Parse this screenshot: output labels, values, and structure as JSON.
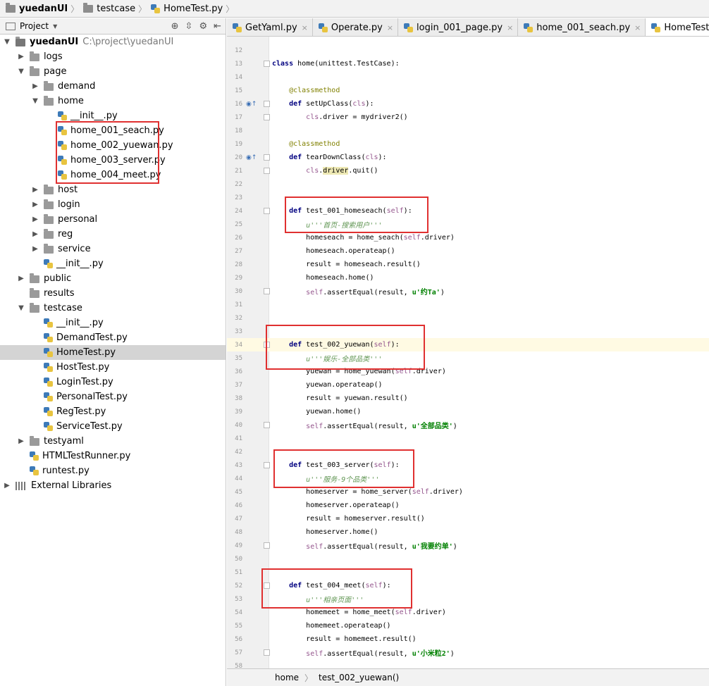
{
  "breadcrumb": [
    {
      "label": "yuedanUI",
      "icon": "folder-icon",
      "bold": true
    },
    {
      "label": "testcase",
      "icon": "folder-icon",
      "bold": false
    },
    {
      "label": "HomeTest.py",
      "icon": "python-file-icon",
      "bold": false
    }
  ],
  "project_panel": {
    "title": "Project",
    "tools": [
      "target-icon",
      "collapse-icon",
      "gear-icon",
      "hide-icon"
    ]
  },
  "tree": [
    {
      "depth": 0,
      "arrow": "open",
      "type": "root",
      "label": "yuedanUI",
      "path": "C:\\project\\yuedanUI"
    },
    {
      "depth": 1,
      "arrow": "closed",
      "type": "dir",
      "label": "logs"
    },
    {
      "depth": 1,
      "arrow": "open",
      "type": "dir",
      "label": "page"
    },
    {
      "depth": 2,
      "arrow": "closed",
      "type": "dir",
      "label": "demand"
    },
    {
      "depth": 2,
      "arrow": "open",
      "type": "dir",
      "label": "home"
    },
    {
      "depth": 3,
      "arrow": "none",
      "type": "file",
      "label": "__init__.py"
    },
    {
      "depth": 3,
      "arrow": "none",
      "type": "file",
      "label": "home_001_seach.py"
    },
    {
      "depth": 3,
      "arrow": "none",
      "type": "file",
      "label": "home_002_yuewan.py"
    },
    {
      "depth": 3,
      "arrow": "none",
      "type": "file",
      "label": "home_003_server.py"
    },
    {
      "depth": 3,
      "arrow": "none",
      "type": "file",
      "label": "home_004_meet.py"
    },
    {
      "depth": 2,
      "arrow": "closed",
      "type": "dir",
      "label": "host"
    },
    {
      "depth": 2,
      "arrow": "closed",
      "type": "dir",
      "label": "login"
    },
    {
      "depth": 2,
      "arrow": "closed",
      "type": "dir",
      "label": "personal"
    },
    {
      "depth": 2,
      "arrow": "closed",
      "type": "dir",
      "label": "reg"
    },
    {
      "depth": 2,
      "arrow": "closed",
      "type": "dir",
      "label": "service"
    },
    {
      "depth": 2,
      "arrow": "none",
      "type": "file",
      "label": "__init__.py"
    },
    {
      "depth": 1,
      "arrow": "closed",
      "type": "dir",
      "label": "public"
    },
    {
      "depth": 1,
      "arrow": "none",
      "type": "dir",
      "label": "results"
    },
    {
      "depth": 1,
      "arrow": "open",
      "type": "dir",
      "label": "testcase"
    },
    {
      "depth": 2,
      "arrow": "none",
      "type": "file",
      "label": "__init__.py"
    },
    {
      "depth": 2,
      "arrow": "none",
      "type": "file",
      "label": "DemandTest.py"
    },
    {
      "depth": 2,
      "arrow": "none",
      "type": "file",
      "label": "HomeTest.py",
      "selected": true
    },
    {
      "depth": 2,
      "arrow": "none",
      "type": "file",
      "label": "HostTest.py"
    },
    {
      "depth": 2,
      "arrow": "none",
      "type": "file",
      "label": "LoginTest.py"
    },
    {
      "depth": 2,
      "arrow": "none",
      "type": "file",
      "label": "PersonalTest.py"
    },
    {
      "depth": 2,
      "arrow": "none",
      "type": "file",
      "label": "RegTest.py"
    },
    {
      "depth": 2,
      "arrow": "none",
      "type": "file",
      "label": "ServiceTest.py"
    },
    {
      "depth": 1,
      "arrow": "closed",
      "type": "dir",
      "label": "testyaml"
    },
    {
      "depth": 1,
      "arrow": "none",
      "type": "file",
      "label": "HTMLTestRunner.py"
    },
    {
      "depth": 1,
      "arrow": "none",
      "type": "file",
      "label": "runtest.py"
    },
    {
      "depth": 0,
      "arrow": "closed",
      "type": "lib",
      "label": "External Libraries"
    }
  ],
  "tabs": [
    {
      "label": "GetYaml.py",
      "active": false
    },
    {
      "label": "Operate.py",
      "active": false
    },
    {
      "label": "login_001_page.py",
      "active": false
    },
    {
      "label": "home_001_seach.py",
      "active": false
    },
    {
      "label": "HomeTest.py",
      "active": true
    }
  ],
  "code_lines": [
    {
      "n": "12",
      "html": ""
    },
    {
      "n": "13",
      "html": "<span class='kw'>class</span> home(unittest.TestCase):",
      "fold": true
    },
    {
      "n": "14",
      "html": ""
    },
    {
      "n": "15",
      "html": "    <span class='deco'>@classmethod</span>"
    },
    {
      "n": "16",
      "html": "    <span class='kw'>def</span> setUpClass(<span class='selfc'>cls</span>):",
      "fold": true,
      "marker": true
    },
    {
      "n": "17",
      "html": "        <span class='selfc'>cls</span>.driver = mydriver2()",
      "fold": true
    },
    {
      "n": "18",
      "html": ""
    },
    {
      "n": "19",
      "html": "    <span class='deco'>@classmethod</span>"
    },
    {
      "n": "20",
      "html": "    <span class='kw'>def</span> tearDownClass(<span class='selfc'>cls</span>):",
      "fold": true,
      "marker": true
    },
    {
      "n": "21",
      "html": "        <span class='selfc'>cls</span>.<span class='hl'>driver</span>.quit()",
      "fold": true
    },
    {
      "n": "22",
      "html": ""
    },
    {
      "n": "23",
      "html": ""
    },
    {
      "n": "24",
      "html": "    <span class='kw'>def</span> test_001_homeseach(<span class='selfc'>self</span>):",
      "fold": true
    },
    {
      "n": "25",
      "html": "        <span class='doc'>u'''首页-搜索用户'''</span>"
    },
    {
      "n": "26",
      "html": "        homeseach = home_seach(<span class='selfc'>self</span>.driver)"
    },
    {
      "n": "27",
      "html": "        homeseach.operateap()"
    },
    {
      "n": "28",
      "html": "        result = homeseach.result()"
    },
    {
      "n": "29",
      "html": "        homeseach.home()"
    },
    {
      "n": "30",
      "html": "        <span class='selfc'>self</span>.assertEqual(result, <span class='str'>u'约Ta'</span>)",
      "fold": true
    },
    {
      "n": "31",
      "html": ""
    },
    {
      "n": "32",
      "html": ""
    },
    {
      "n": "33",
      "html": ""
    },
    {
      "n": "34",
      "html": "    <span class='kw'>def</span> test_002_yuewan(<span class='selfc'>self</span>):",
      "fold": true,
      "current": true
    },
    {
      "n": "35",
      "html": "        <span class='doc'>u'''娱乐-全部品类'''</span>"
    },
    {
      "n": "36",
      "html": "        yuewan = home_yuewan(<span class='selfc'>self</span>.driver)"
    },
    {
      "n": "37",
      "html": "        yuewan.operateap()"
    },
    {
      "n": "38",
      "html": "        result = yuewan.result()"
    },
    {
      "n": "39",
      "html": "        yuewan.home()"
    },
    {
      "n": "40",
      "html": "        <span class='selfc'>self</span>.assertEqual(result, <span class='str'>u'全部品类'</span>)",
      "fold": true
    },
    {
      "n": "41",
      "html": ""
    },
    {
      "n": "42",
      "html": ""
    },
    {
      "n": "43",
      "html": "    <span class='kw'>def</span> test_003_server(<span class='selfc'>self</span>):",
      "fold": true
    },
    {
      "n": "44",
      "html": "        <span class='doc'>u'''服务-9个品类'''</span>"
    },
    {
      "n": "45",
      "html": "        homeserver = home_server(<span class='selfc'>self</span>.driver)"
    },
    {
      "n": "46",
      "html": "        homeserver.operateap()"
    },
    {
      "n": "47",
      "html": "        result = homeserver.result()"
    },
    {
      "n": "48",
      "html": "        homeserver.home()"
    },
    {
      "n": "49",
      "html": "        <span class='selfc'>self</span>.assertEqual(result, <span class='str'>u'我要约单'</span>)",
      "fold": true
    },
    {
      "n": "50",
      "html": ""
    },
    {
      "n": "51",
      "html": ""
    },
    {
      "n": "52",
      "html": "    <span class='kw'>def</span> test_004_meet(<span class='selfc'>self</span>):",
      "fold": true
    },
    {
      "n": "53",
      "html": "        <span class='doc'>u'''相亲页面'''</span>"
    },
    {
      "n": "54",
      "html": "        homemeet = home_meet(<span class='selfc'>self</span>.driver)"
    },
    {
      "n": "55",
      "html": "        homemeet.operateap()"
    },
    {
      "n": "56",
      "html": "        result = homemeet.result()"
    },
    {
      "n": "57",
      "html": "        <span class='selfc'>self</span>.assertEqual(result, <span class='str'>u'小米粒2'</span>)",
      "fold": true
    },
    {
      "n": "58",
      "html": ""
    }
  ],
  "footer_breadcrumb": [
    "home",
    "test_002_yuewan()"
  ],
  "colors": {
    "highlight_box": "#e03030",
    "current_line": "#fffae3",
    "selected_row": "#d4d4d4"
  }
}
